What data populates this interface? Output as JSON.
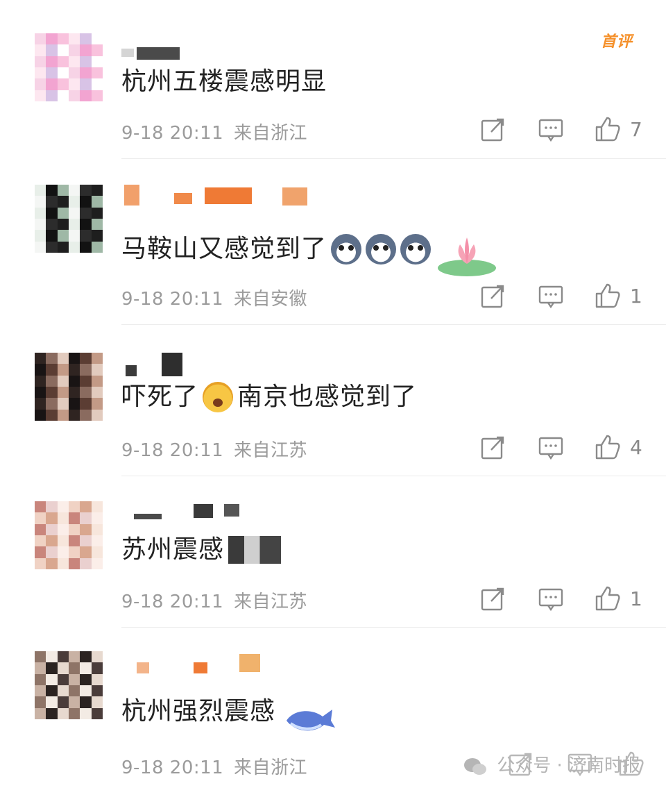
{
  "first_badge": "首评",
  "comments": [
    {
      "text": "杭州五楼震感明显",
      "time": "9-18 20:11",
      "location": "来自浙江",
      "likes": "7",
      "avatar_colors": [
        "#f7d3e6",
        "#f2a4d1",
        "#f9c2dd",
        "#fde7f0",
        "#d8c3e6",
        "#ffffff"
      ]
    },
    {
      "text": "马鞍山又感觉到了",
      "time": "9-18 20:11",
      "location": "来自安徽",
      "likes": "1",
      "avatar_colors": [
        "#1e1e1e",
        "#e8efe9",
        "#121212",
        "#9fb8a6",
        "#f4f6f4",
        "#2c2c2c"
      ]
    },
    {
      "text_before": "吓死了",
      "text_after": "南京也感觉到了",
      "time": "9-18 20:11",
      "location": "来自江苏",
      "likes": "4",
      "avatar_colors": [
        "#5b3d33",
        "#c39a86",
        "#2f2421",
        "#8a6b5f",
        "#e2cbbe",
        "#191414"
      ]
    },
    {
      "text": "苏州震感",
      "time": "9-18 20:11",
      "location": "来自江苏",
      "likes": "1",
      "avatar_colors": [
        "#f0d2c4",
        "#d9a78f",
        "#f7e6dc",
        "#c9857c",
        "#ead0cf",
        "#fbeee9"
      ]
    },
    {
      "text": "杭州强烈震感",
      "time": "9-18 20:11",
      "location": "来自浙江",
      "likes": "",
      "avatar_colors": [
        "#4a3c3a",
        "#c9b2a4",
        "#2b2321",
        "#e7d9cf",
        "#8e7467",
        "#f3ebe4"
      ]
    }
  ],
  "watermark": "公众号 · 济南时报",
  "colors": {
    "badge": "#f5902a",
    "meta": "#9b9b9b",
    "divider": "#ececec"
  }
}
